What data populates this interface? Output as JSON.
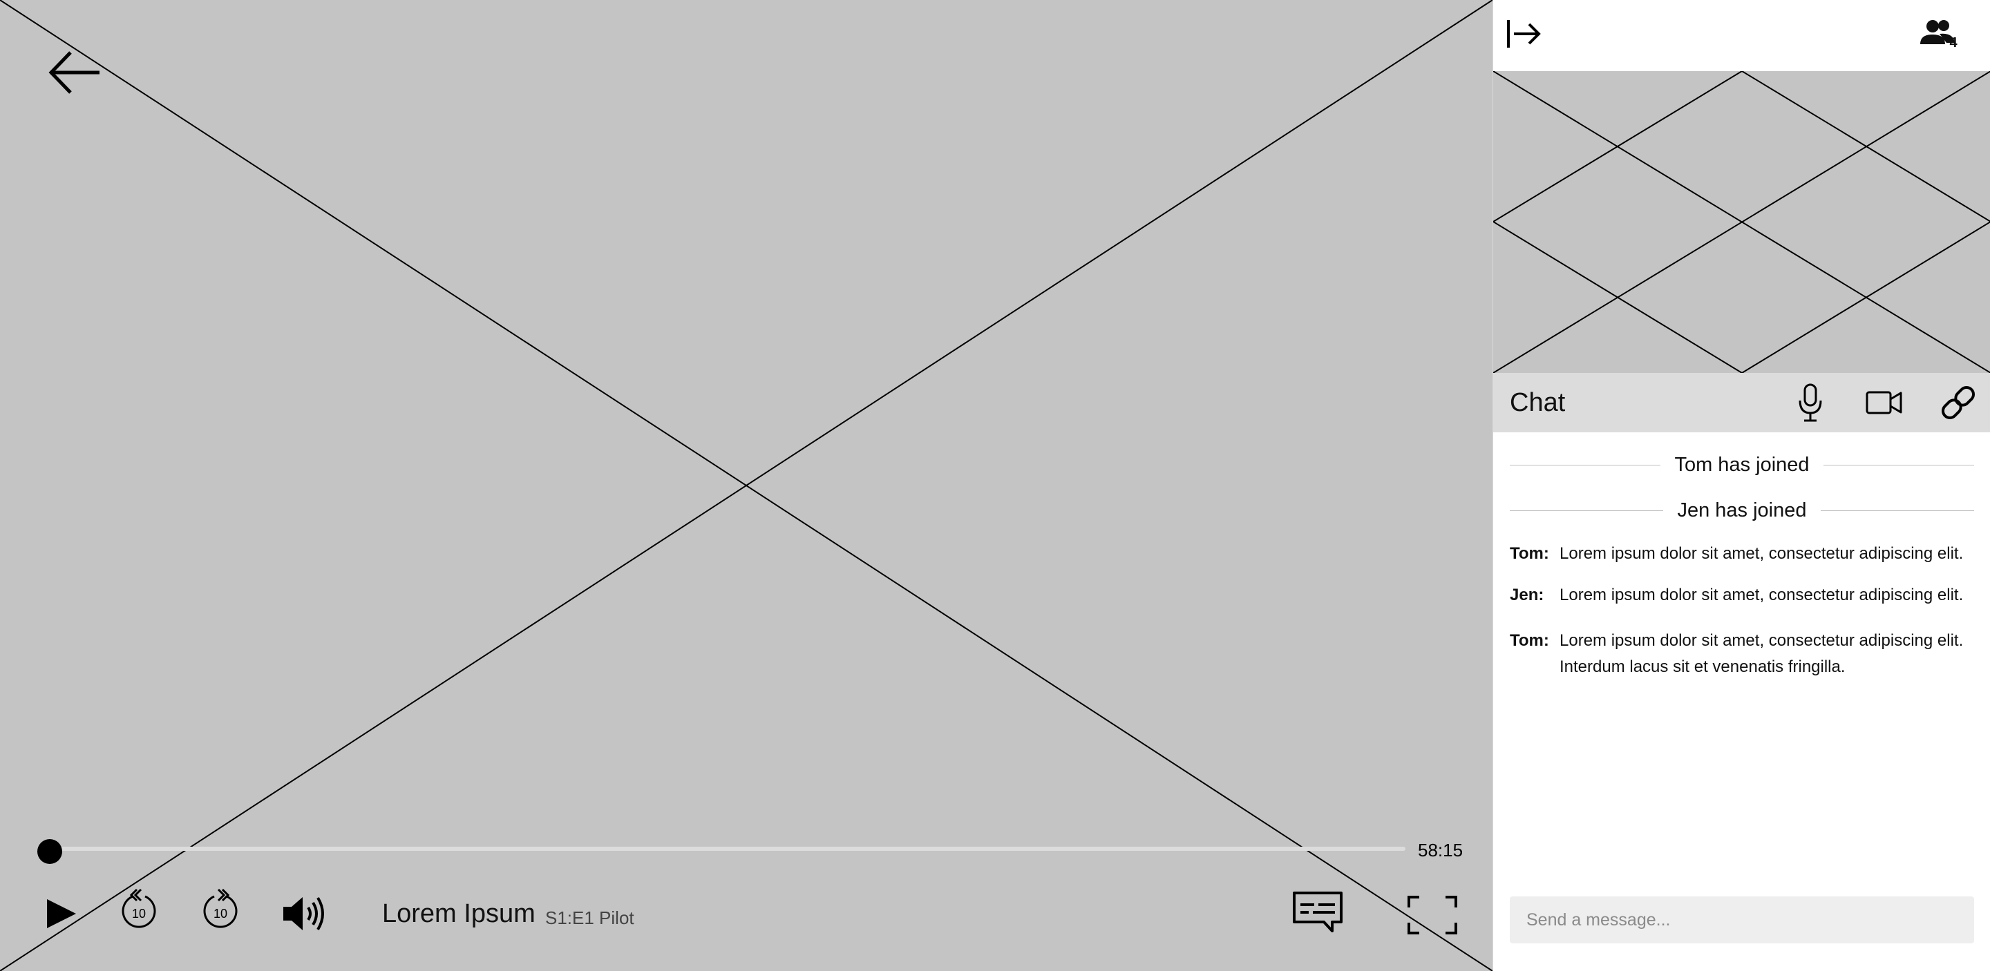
{
  "player": {
    "progress": 0.0,
    "time_remaining": "58:15",
    "title": "Lorem Ipsum",
    "episode": "S1:E1 Pilot",
    "rewind_seconds": "10",
    "forward_seconds": "10"
  },
  "sidebar": {
    "participant_count": "4",
    "chat_title": "Chat",
    "events": [
      {
        "text": "Tom has joined"
      },
      {
        "text": "Jen has joined"
      }
    ],
    "messages": [
      {
        "author": "Tom:",
        "text": "Lorem ipsum dolor sit amet, consectetur adipiscing elit."
      },
      {
        "author": "Jen:",
        "text": "Lorem ipsum dolor sit amet, consectetur adipiscing elit."
      },
      {
        "author": "Tom:",
        "text": "Lorem ipsum dolor sit amet, consectetur adipiscing elit. Interdum lacus sit et venenatis fringilla."
      }
    ],
    "input_placeholder": "Send a message..."
  },
  "colors": {
    "placeholder_gray": "#c4c4c4",
    "chat_header_bg": "#dcdcdc",
    "input_bg": "#eeeeee",
    "icon": "#111111"
  },
  "icons": {
    "back": "arrow-left-icon",
    "play": "play-icon",
    "rewind": "rewind-10-icon",
    "forward": "forward-10-icon",
    "volume": "volume-icon",
    "subtitles": "subtitles-icon",
    "fullscreen": "fullscreen-icon",
    "collapse": "collapse-panel-icon",
    "participants": "participants-icon",
    "mic": "microphone-icon",
    "camera": "video-camera-icon",
    "link": "link-icon"
  }
}
